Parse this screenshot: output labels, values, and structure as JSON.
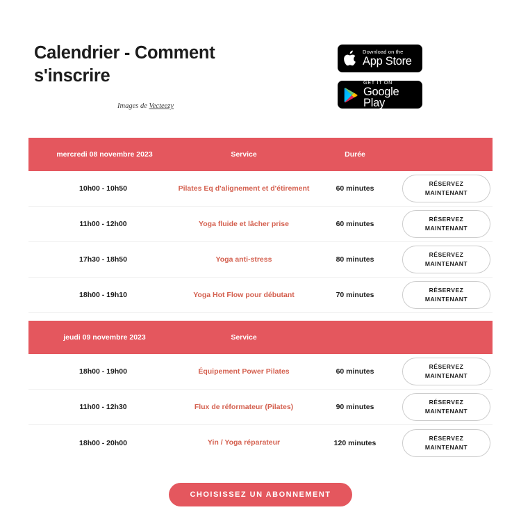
{
  "header": {
    "title": "Calendrier - Comment s'inscrire",
    "credit_prefix": "Images de ",
    "credit_link": "Vecteezy"
  },
  "badges": [
    {
      "icon": "apple-icon",
      "small": "Download on the",
      "big": "App Store"
    },
    {
      "icon": "google-play-icon",
      "small": "GET IT ON",
      "big": "Google Play"
    }
  ],
  "schedule": {
    "columns": {
      "time": "",
      "service": "Service",
      "duration": "Durée",
      "action": ""
    },
    "sections": [
      {
        "day": "mercredi 08 novembre 2023",
        "service_header": "Service",
        "duration_header": "Durée",
        "rows": [
          {
            "time": "10h00 - 10h50",
            "service": "Pilates Eq d'alignement et d'étirement",
            "duration": "60 minutes",
            "action": "RÉSERVEZ MAINTENANT"
          },
          {
            "time": "11h00 - 12h00",
            "service": "Yoga fluide et lâcher prise",
            "duration": "60 minutes",
            "action": "RÉSERVEZ MAINTENANT"
          },
          {
            "time": "17h30 - 18h50",
            "service": "Yoga anti-stress",
            "duration": "80 minutes",
            "action": "RÉSERVEZ MAINTENANT"
          },
          {
            "time": "18h00 - 19h10",
            "service": "Yoga Hot Flow pour débutant",
            "duration": "70 minutes",
            "action": "RÉSERVEZ MAINTENANT"
          }
        ]
      },
      {
        "day": "jeudi 09 novembre 2023",
        "service_header": "Service",
        "duration_header": "",
        "rows": [
          {
            "time": "18h00 - 19h00",
            "service": "Équipement Power Pilates",
            "duration": "60 minutes",
            "action": "RÉSERVEZ MAINTENANT"
          },
          {
            "time": "11h00 - 12h30",
            "service": "Flux de réformateur (Pilates)",
            "duration": "90 minutes",
            "action": "RÉSERVEZ MAINTENANT"
          },
          {
            "time": "18h00 - 20h00",
            "service": "Yin / Yoga réparateur",
            "duration": "120 minutes",
            "action": "RÉSERVEZ MAINTENANT"
          }
        ]
      }
    ]
  },
  "cta": {
    "label": "CHOISISSEZ UN ABONNEMENT"
  },
  "colors": {
    "accent": "#e4575e",
    "service_text": "#d4604f",
    "text": "#1c1c1c",
    "badge_bg": "#000000"
  }
}
